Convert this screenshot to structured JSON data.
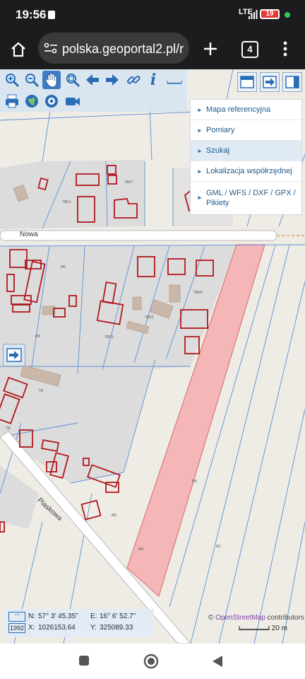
{
  "status": {
    "time": "19:56",
    "network": "LTE",
    "battery": "19"
  },
  "browser": {
    "url": "polska.geoportal2.pl/r",
    "tab_count": "4"
  },
  "menu": {
    "items": [
      {
        "label": "Mapa referencyjna"
      },
      {
        "label": "Pomiary"
      },
      {
        "label": "Szukaj"
      },
      {
        "label": "Lokalizacja współrzędnej"
      },
      {
        "label": "GML / WFS / DXF / GPX / Pikiety"
      }
    ]
  },
  "map": {
    "street_nowa": "Nowa",
    "street_piaskowa": "Piaskowa",
    "attribution_prefix": "©",
    "attribution_link": "OpenStreetMap",
    "attribution_suffix": "contributors",
    "scale_label": "20 m",
    "parcel_labels": [
      "785/7",
      "785/1",
      "8/6",
      "8/8",
      "785/2",
      "785/3",
      "785/4",
      "7/9",
      "7/6",
      "8/6",
      "8/5",
      "8/4",
      "8/1"
    ]
  },
  "coords": {
    "epsg_label": "1992",
    "n_label": "N:",
    "n_value": "57° 3' 45.35\"",
    "e_label": "E:",
    "e_value": "16° 6' 52.7\"",
    "x_label": "X:",
    "x_value": "1026153.64",
    "y_label": "Y:",
    "y_value": "325089.33"
  },
  "colors": {
    "accent": "#1f5a8a",
    "highlight_parcel": "#f4b6b6",
    "building_outline": "#b0181e"
  }
}
